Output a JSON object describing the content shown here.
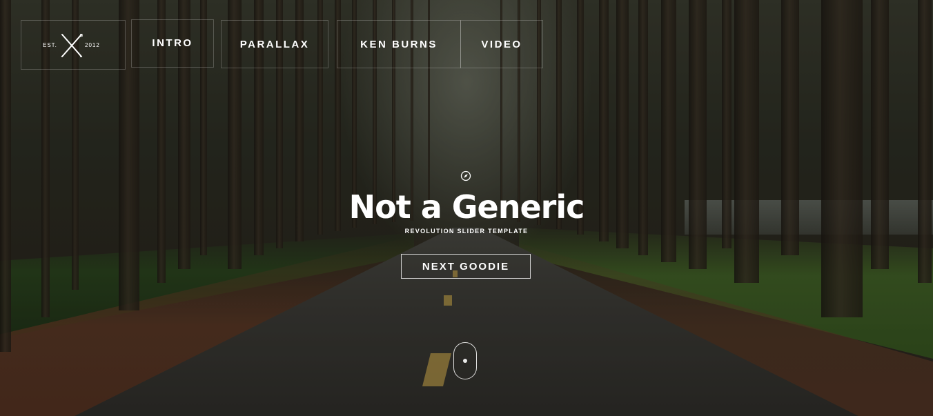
{
  "logo": {
    "est_label": "EST.",
    "year": "2012",
    "icon": "crossed-arrows-icon"
  },
  "nav": {
    "items": [
      {
        "label": "INTRO"
      },
      {
        "label": "PARALLAX"
      },
      {
        "label": "KEN BURNS"
      },
      {
        "label": "VIDEO"
      }
    ]
  },
  "hero": {
    "icon": "compass-icon",
    "title": "Not a Generic",
    "subtitle": "REVOLUTION SLIDER TEMPLATE",
    "cta_label": "NEXT GOODIE",
    "scroll_icon": "mouse-scroll-icon"
  },
  "colors": {
    "text": "#ffffff",
    "border": "#ffffff"
  }
}
